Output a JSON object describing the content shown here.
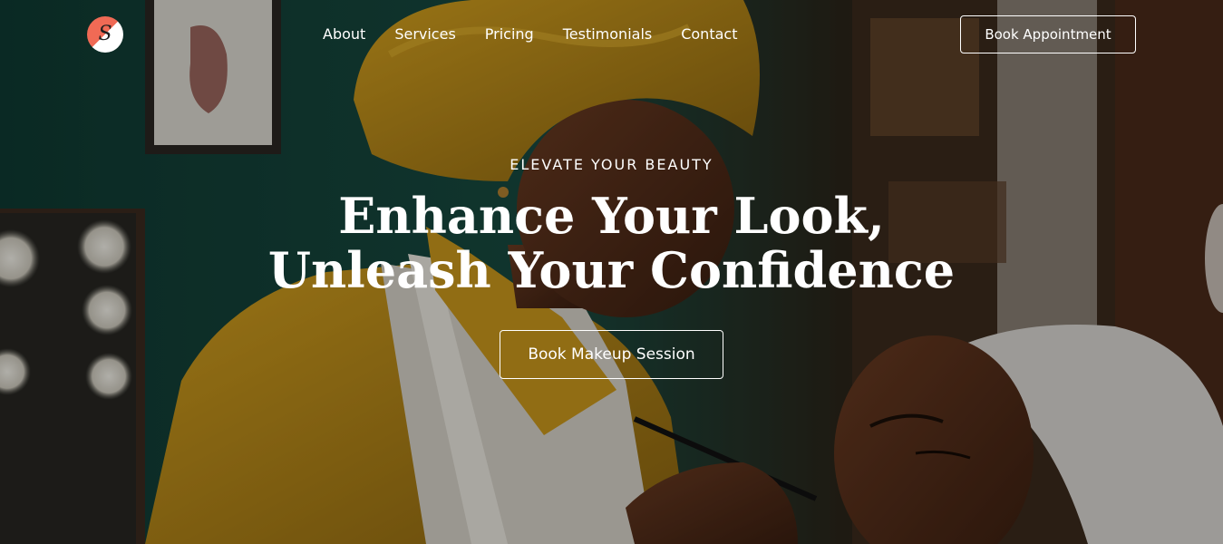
{
  "brand": {
    "logo_letter": "S",
    "accent": "#f06a55"
  },
  "nav": {
    "links": [
      {
        "label": "About"
      },
      {
        "label": "Services"
      },
      {
        "label": "Pricing"
      },
      {
        "label": "Testimonials"
      },
      {
        "label": "Contact"
      }
    ],
    "cta_label": "Book Appointment"
  },
  "hero": {
    "eyebrow": "ELEVATE YOUR BEAUTY",
    "headline_line1": "Enhance Your Look,",
    "headline_line2": "Unleash Your Confidence",
    "cta_label": "Book Makeup Session",
    "background_image": "makeup-artist-applying-makeup-to-client-photo"
  }
}
